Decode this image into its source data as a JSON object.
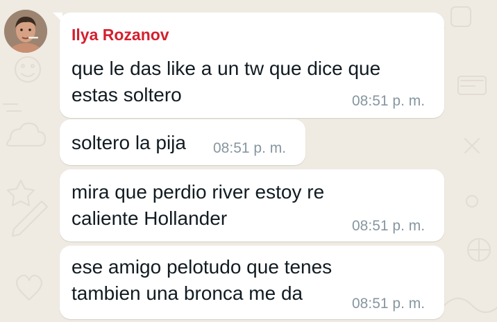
{
  "chat": {
    "sender_name": "Ilya Rozanov",
    "sender_color": "#d3202f",
    "messages": [
      {
        "lines": [
          "que le das like a un tw que dice que",
          "estas soltero"
        ],
        "time": "08:51 p. m."
      },
      {
        "lines": [
          "soltero la pija"
        ],
        "time": "08:51 p. m."
      },
      {
        "lines": [
          "mira que perdio river estoy re",
          "caliente Hollander"
        ],
        "time": "08:51 p. m."
      },
      {
        "lines": [
          "ese amigo pelotudo que tenes",
          "tambien una bronca me da"
        ],
        "time": "08:51 p. m."
      }
    ]
  },
  "theme": {
    "wallpaper": "#efeae2",
    "bubble": "#ffffff",
    "time_color": "#8696a0",
    "text_color": "#111b21"
  },
  "icons": [
    "avatar"
  ]
}
